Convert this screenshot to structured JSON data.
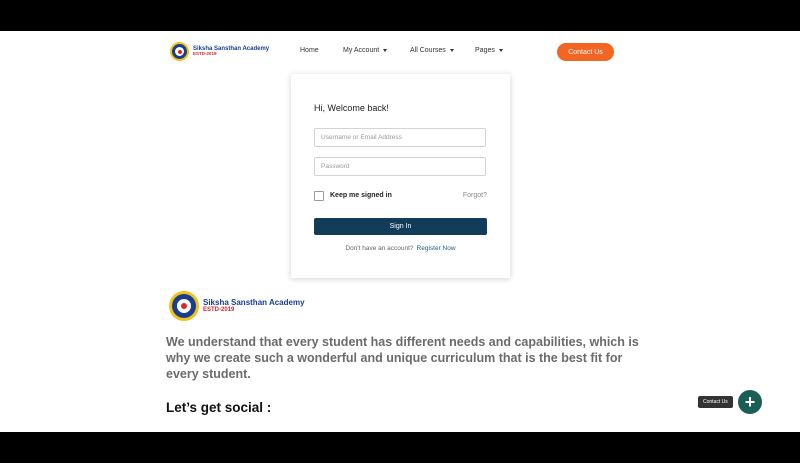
{
  "header": {
    "logo": {
      "name": "Siksha Sansthan Academy",
      "estd": "ESTD-2019"
    },
    "nav": [
      {
        "label": "Home"
      },
      {
        "label": "My Account"
      },
      {
        "label": "All Courses"
      },
      {
        "label": "Pages"
      }
    ],
    "contact_label": "Contact Us"
  },
  "login": {
    "welcome": "Hi, Welcome back!",
    "username_placeholder": "Username or Email Address",
    "password_placeholder": "Password",
    "remember_label": "Keep me signed in",
    "forgot_label": "Forgot?",
    "signin_label": "Sign In",
    "no_account_text": "Don't have an account?",
    "register_label": "Register Now"
  },
  "footer": {
    "logo": {
      "name": "Siksha Sansthan Academy",
      "estd": "ESTD-2019"
    },
    "description": "We understand that every student has different needs and capabilities, which is why we create such a wonderful and unique curriculum that is the best fit for every student.",
    "social_heading": "Let’s get social :"
  },
  "floating": {
    "tooltip": "Contact Us",
    "fab_icon": "plus-icon"
  },
  "colors": {
    "accent_orange": "#f26522",
    "signin_navy": "#123c5a",
    "fab_green": "#1b5e55",
    "logo_blue": "#1b3d8f",
    "logo_red": "#d8262d",
    "logo_yellow": "#f2c21b"
  }
}
